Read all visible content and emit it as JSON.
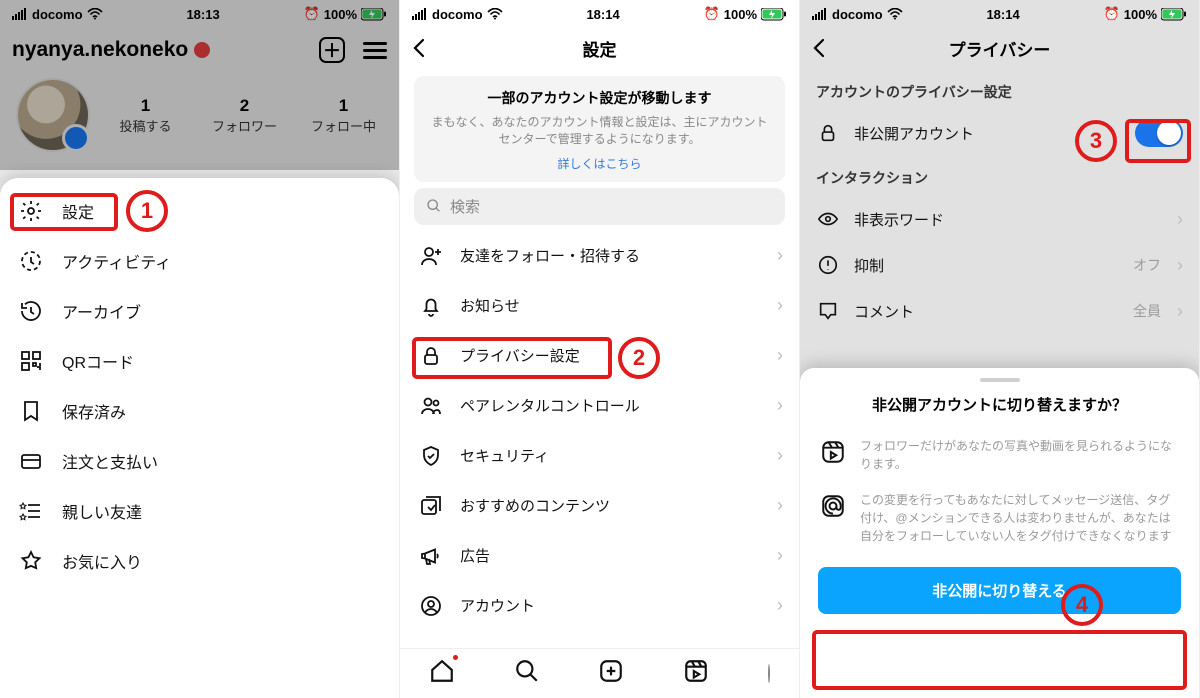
{
  "status": {
    "carrier": "docomo",
    "battery": "100%",
    "times": [
      "18:13",
      "18:14",
      "18:14"
    ]
  },
  "annotations": {
    "n1": "1",
    "n2": "2",
    "n3": "3",
    "n4": "4"
  },
  "phone1": {
    "username": "nyanya.nekoneko",
    "stats": [
      {
        "value": "1",
        "label": "投稿する"
      },
      {
        "value": "2",
        "label": "フォロワー"
      },
      {
        "value": "1",
        "label": "フォロー中"
      }
    ],
    "menu": [
      "設定",
      "アクティビティ",
      "アーカイブ",
      "QRコード",
      "保存済み",
      "注文と支払い",
      "親しい友達",
      "お気に入り"
    ]
  },
  "phone2": {
    "title": "設定",
    "notice": {
      "heading": "一部のアカウント設定が移動します",
      "body": "まもなく、あなたのアカウント情報と設定は、主にアカウントセンターで管理するようになります。",
      "link": "詳しくはこちら"
    },
    "search_placeholder": "検索",
    "items": [
      "友達をフォロー・招待する",
      "お知らせ",
      "プライバシー設定",
      "ペアレンタルコントロール",
      "セキュリティ",
      "おすすめのコンテンツ",
      "広告",
      "アカウント"
    ]
  },
  "phone3": {
    "title": "プライバシー",
    "section_privacy": "アカウントのプライバシー設定",
    "private_account": "非公開アカウント",
    "section_interaction": "インタラクション",
    "rows": [
      {
        "label": "非表示ワード",
        "meta": ""
      },
      {
        "label": "抑制",
        "meta": "オフ"
      },
      {
        "label": "コメント",
        "meta": "全員"
      }
    ],
    "sheet": {
      "heading": "非公開アカウントに切り替えますか？",
      "info1": "フォロワーだけがあなたの写真や動画を見られるようになります。",
      "info2": "この変更を行ってもあなたに対してメッセージ送信、タグ付け、@メンションできる人は変わりませんが、あなたは自分をフォローしていない人をタグ付けできなくなります",
      "button": "非公開に切り替える"
    }
  }
}
